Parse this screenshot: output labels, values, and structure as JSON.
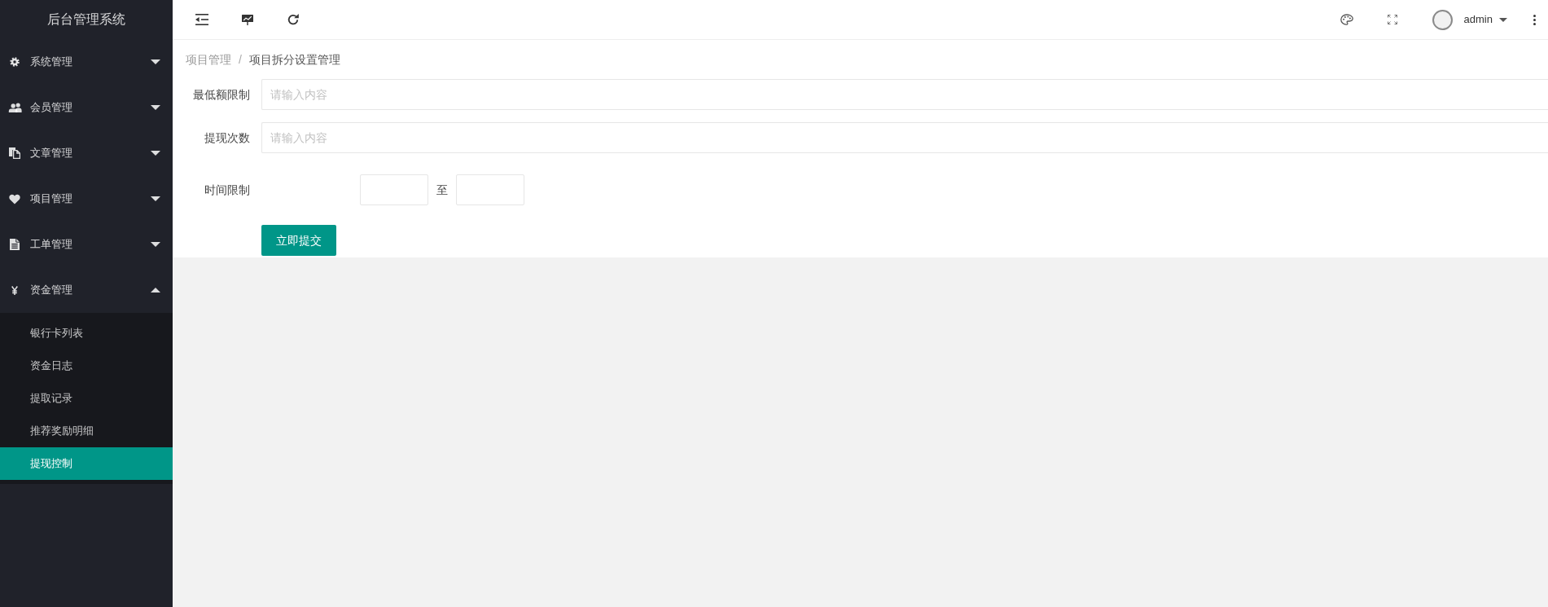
{
  "sidebar": {
    "title": "后台管理系统",
    "menu": [
      {
        "label": "系统管理",
        "expanded": false
      },
      {
        "label": "会员管理",
        "expanded": false
      },
      {
        "label": "文章管理",
        "expanded": false
      },
      {
        "label": "项目管理",
        "expanded": false
      },
      {
        "label": "工单管理",
        "expanded": false
      },
      {
        "label": "资金管理",
        "expanded": true,
        "children": [
          {
            "label": "银行卡列表",
            "selected": false
          },
          {
            "label": "资金日志",
            "selected": false
          },
          {
            "label": "提取记录",
            "selected": false
          },
          {
            "label": "推荐奖励明细",
            "selected": false
          },
          {
            "label": "提现控制",
            "selected": true
          }
        ]
      }
    ]
  },
  "header": {
    "user": "admin"
  },
  "breadcrumb": {
    "items": [
      "项目管理",
      "项目拆分设置管理"
    ],
    "separator": "/"
  },
  "form": {
    "fields": [
      {
        "kind": "text",
        "label": "最低额限制",
        "placeholder": "请输入内容"
      },
      {
        "kind": "text",
        "label": "提现次数",
        "placeholder": "请输入内容"
      },
      {
        "kind": "range",
        "label": "时间限制",
        "separator": "至"
      }
    ],
    "submit": "立即提交"
  }
}
